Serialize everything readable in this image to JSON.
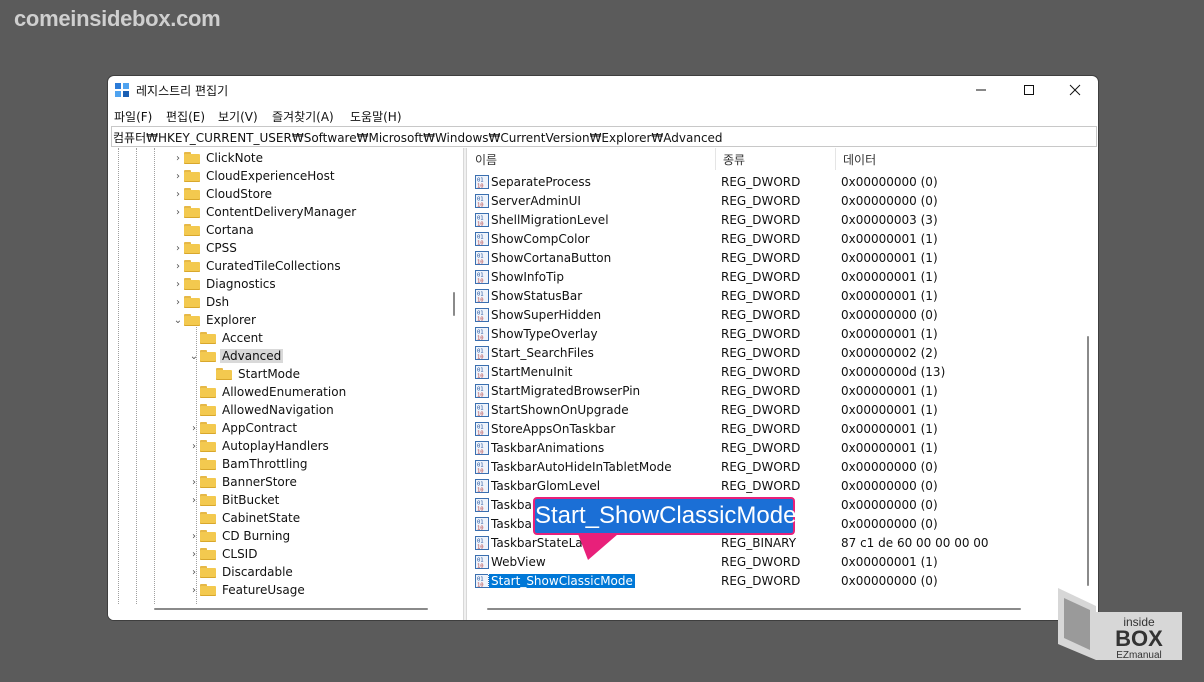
{
  "watermark": {
    "site": "comeinsidebox.com"
  },
  "window": {
    "title": "레지스트리 편집기",
    "controls": {
      "minimize": "—",
      "maximize": "☐",
      "close": "✕"
    },
    "menu": [
      "파일(F)",
      "편집(E)",
      "보기(V)",
      "즐겨찾기(A)",
      "도움말(H)"
    ],
    "address": "컴퓨터₩HKEY_CURRENT_USER₩Software₩Microsoft₩Windows₩CurrentVersion₩Explorer₩Advanced"
  },
  "tree": [
    {
      "label": "ClickNote",
      "level": 0,
      "expander": "›"
    },
    {
      "label": "CloudExperienceHost",
      "level": 0,
      "expander": "›"
    },
    {
      "label": "CloudStore",
      "level": 0,
      "expander": "›"
    },
    {
      "label": "ContentDeliveryManager",
      "level": 0,
      "expander": "›"
    },
    {
      "label": "Cortana",
      "level": 0,
      "expander": ""
    },
    {
      "label": "CPSS",
      "level": 0,
      "expander": "›"
    },
    {
      "label": "CuratedTileCollections",
      "level": 0,
      "expander": "›"
    },
    {
      "label": "Diagnostics",
      "level": 0,
      "expander": "›"
    },
    {
      "label": "Dsh",
      "level": 0,
      "expander": "›"
    },
    {
      "label": "Explorer",
      "level": 0,
      "expander": "⌄"
    },
    {
      "label": "Accent",
      "level": 1,
      "expander": ""
    },
    {
      "label": "Advanced",
      "level": 1,
      "expander": "⌄",
      "selected": true
    },
    {
      "label": "StartMode",
      "level": 2,
      "expander": ""
    },
    {
      "label": "AllowedEnumeration",
      "level": 1,
      "expander": ""
    },
    {
      "label": "AllowedNavigation",
      "level": 1,
      "expander": ""
    },
    {
      "label": "AppContract",
      "level": 1,
      "expander": "›"
    },
    {
      "label": "AutoplayHandlers",
      "level": 1,
      "expander": "›"
    },
    {
      "label": "BamThrottling",
      "level": 1,
      "expander": ""
    },
    {
      "label": "BannerStore",
      "level": 1,
      "expander": "›"
    },
    {
      "label": "BitBucket",
      "level": 1,
      "expander": "›"
    },
    {
      "label": "CabinetState",
      "level": 1,
      "expander": ""
    },
    {
      "label": "CD Burning",
      "level": 1,
      "expander": "›"
    },
    {
      "label": "CLSID",
      "level": 1,
      "expander": "›"
    },
    {
      "label": "Discardable",
      "level": 1,
      "expander": "›"
    },
    {
      "label": "FeatureUsage",
      "level": 1,
      "expander": "›"
    }
  ],
  "list": {
    "headers": {
      "name": "이름",
      "type": "종류",
      "data": "데이터"
    },
    "rows": [
      {
        "name": "SeparateProcess",
        "type": "REG_DWORD",
        "data": "0x00000000 (0)"
      },
      {
        "name": "ServerAdminUI",
        "type": "REG_DWORD",
        "data": "0x00000000 (0)"
      },
      {
        "name": "ShellMigrationLevel",
        "type": "REG_DWORD",
        "data": "0x00000003 (3)"
      },
      {
        "name": "ShowCompColor",
        "type": "REG_DWORD",
        "data": "0x00000001 (1)"
      },
      {
        "name": "ShowCortanaButton",
        "type": "REG_DWORD",
        "data": "0x00000001 (1)"
      },
      {
        "name": "ShowInfoTip",
        "type": "REG_DWORD",
        "data": "0x00000001 (1)"
      },
      {
        "name": "ShowStatusBar",
        "type": "REG_DWORD",
        "data": "0x00000001 (1)"
      },
      {
        "name": "ShowSuperHidden",
        "type": "REG_DWORD",
        "data": "0x00000000 (0)"
      },
      {
        "name": "ShowTypeOverlay",
        "type": "REG_DWORD",
        "data": "0x00000001 (1)"
      },
      {
        "name": "Start_SearchFiles",
        "type": "REG_DWORD",
        "data": "0x00000002 (2)"
      },
      {
        "name": "StartMenuInit",
        "type": "REG_DWORD",
        "data": "0x0000000d (13)"
      },
      {
        "name": "StartMigratedBrowserPin",
        "type": "REG_DWORD",
        "data": "0x00000001 (1)"
      },
      {
        "name": "StartShownOnUpgrade",
        "type": "REG_DWORD",
        "data": "0x00000001 (1)"
      },
      {
        "name": "StoreAppsOnTaskbar",
        "type": "REG_DWORD",
        "data": "0x00000001 (1)"
      },
      {
        "name": "TaskbarAnimations",
        "type": "REG_DWORD",
        "data": "0x00000001 (1)"
      },
      {
        "name": "TaskbarAutoHideInTabletMode",
        "type": "REG_DWORD",
        "data": "0x00000000 (0)"
      },
      {
        "name": "TaskbarGlomLevel",
        "type": "REG_DWORD",
        "data": "0x00000000 (0)"
      },
      {
        "name": "Taskbar",
        "type": "",
        "data": "0x00000000 (0)"
      },
      {
        "name": "Taskbar",
        "type": "",
        "data": "0x00000000 (0)"
      },
      {
        "name": "TaskbarStateLas",
        "type": "REG_BINARY",
        "data": "87 c1 de 60 00 00 00 00"
      },
      {
        "name": "WebView",
        "type": "REG_DWORD",
        "data": "0x00000001 (1)"
      },
      {
        "name": "Start_ShowClassicMode",
        "type": "REG_DWORD",
        "data": "0x00000000 (0)",
        "selected": true
      }
    ]
  },
  "callout": {
    "text": "Start_ShowClassicMode",
    "color": "#1b6fd6",
    "border": "#e8207a"
  },
  "logo": {
    "line1": "inside",
    "line2": "BOX",
    "line3": "EZmanual"
  }
}
